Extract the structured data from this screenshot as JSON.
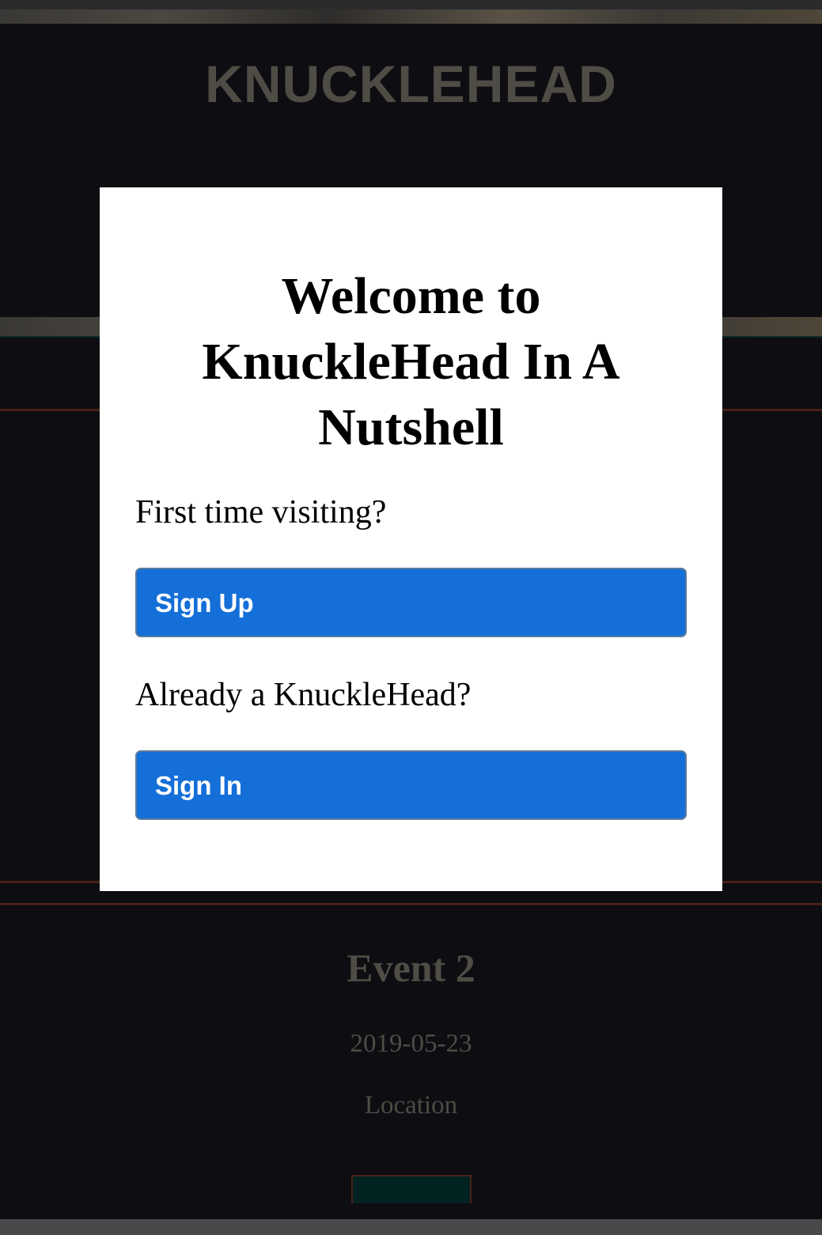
{
  "background_page": {
    "brand": "KNUCKLEHEAD",
    "event": {
      "title": "Event 2",
      "date": "2019-05-23",
      "location": "Location"
    }
  },
  "modal": {
    "title": "Welcome to KnuckleHead In A Nutshell",
    "first_time_prompt": "First time visiting?",
    "sign_up_label": "Sign Up",
    "returning_prompt": "Already a KnuckleHead?",
    "sign_in_label": "Sign In"
  },
  "colors": {
    "button_blue": "#146fd8",
    "page_background": "#0e0d11",
    "dimmed_text": "#4e4c45",
    "accent_rule": "#4a2116"
  }
}
